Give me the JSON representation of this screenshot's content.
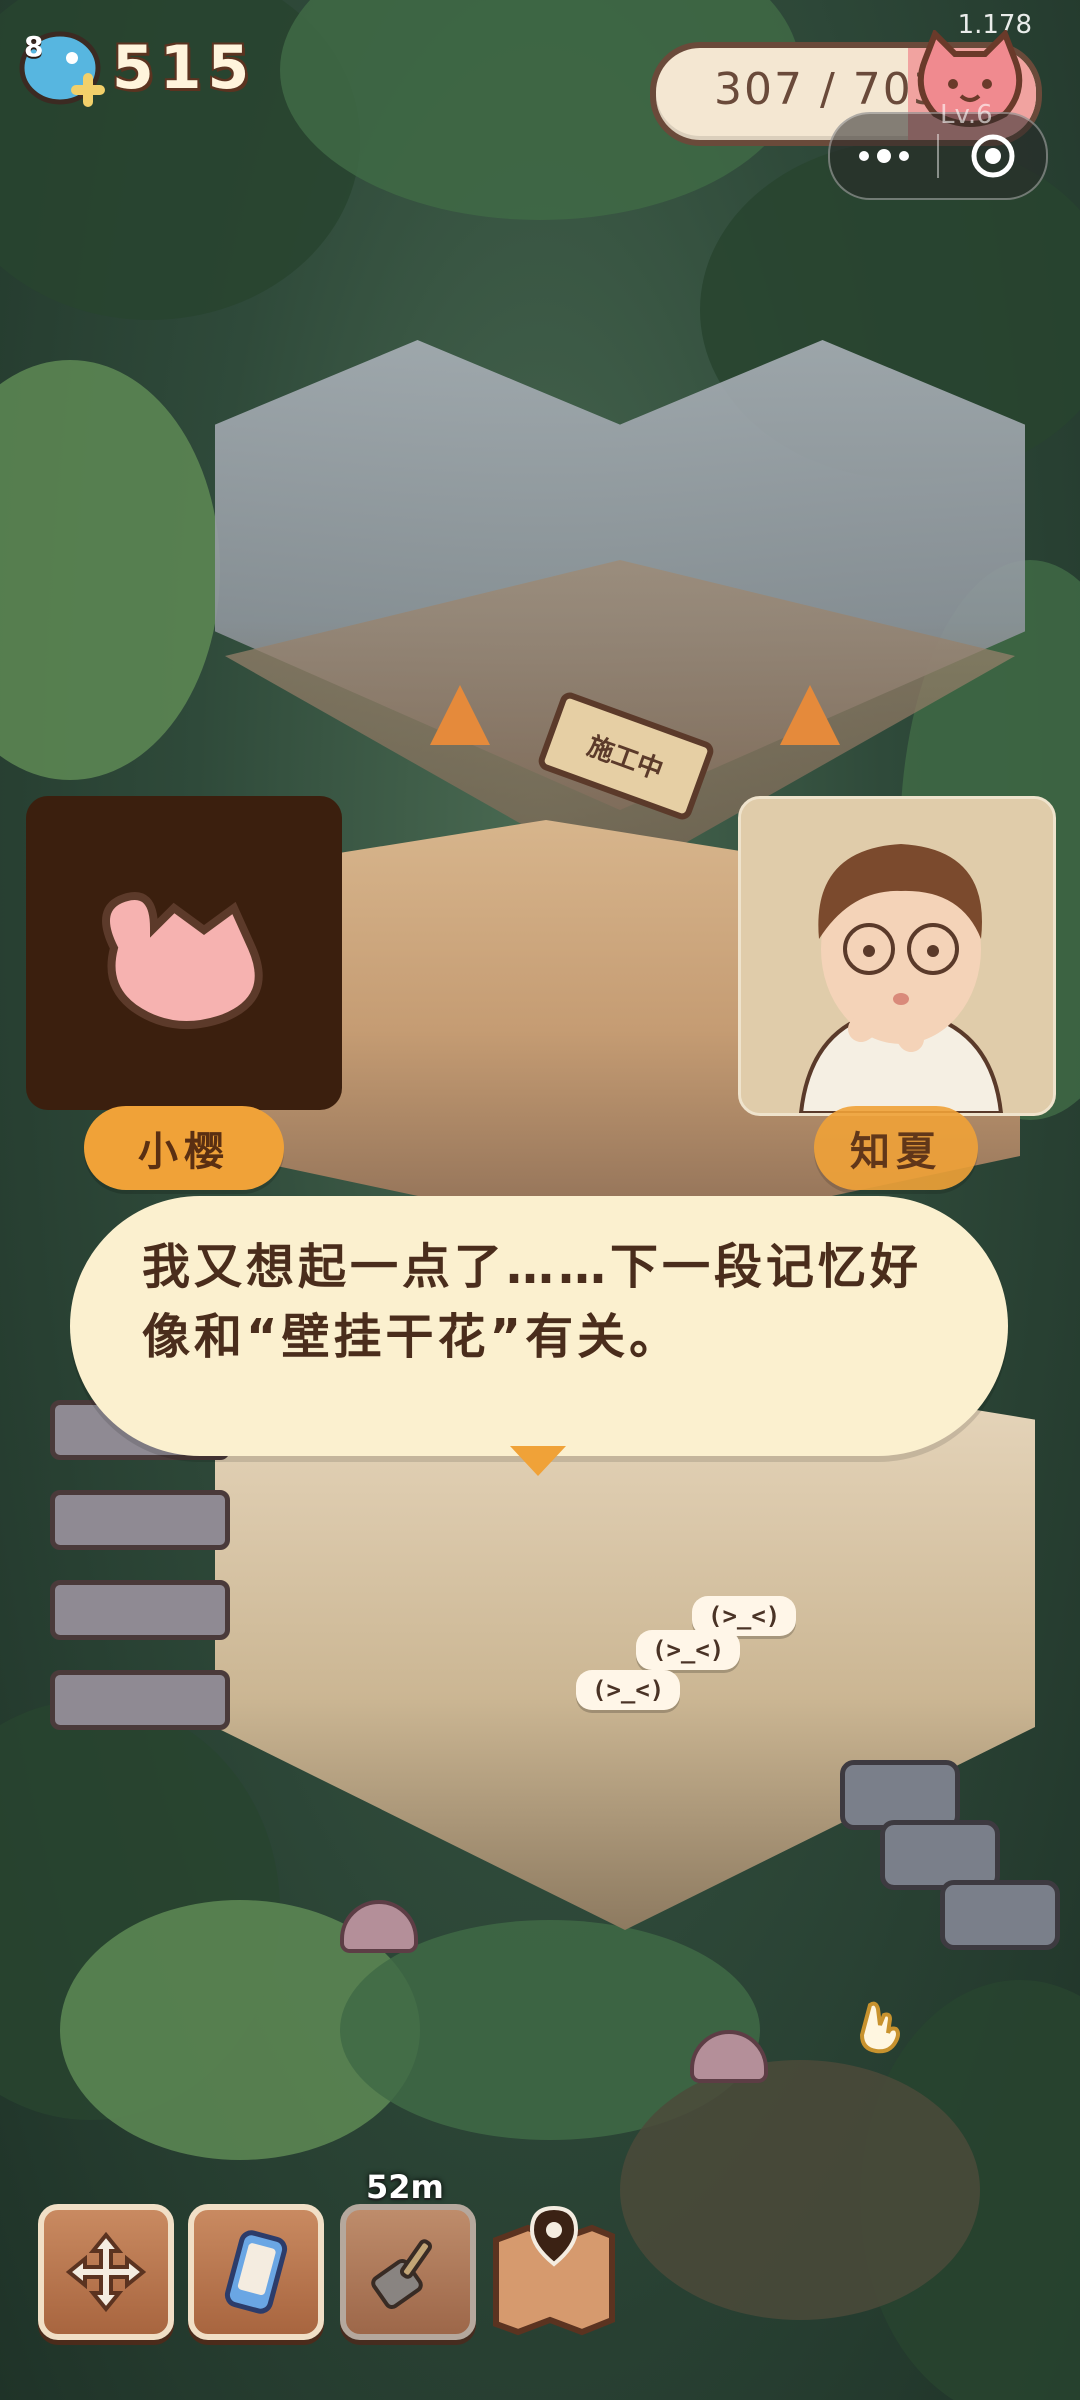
{
  "hud": {
    "level": "8",
    "currency_amount": "515",
    "version": "1.178",
    "progress": {
      "current": 307,
      "max": 703,
      "text": "307 / 703"
    },
    "cat_level": "Lv.6"
  },
  "scene": {
    "sign_text": "施工中",
    "bubbles": [
      "(>_<)",
      "(>_<)",
      "(>_<)"
    ]
  },
  "dialog": {
    "speaker_left": "小樱",
    "speaker_right": "知夏",
    "text": "我又想起一点了……下一段记忆好像和“壁挂干花”有关。"
  },
  "toolbar": {
    "timer": "52m",
    "items": [
      "move-tool",
      "phone-tool",
      "scoop-tool",
      "map-tool"
    ]
  },
  "colors": {
    "accent_orange": "#f0a238",
    "dialog_bg": "#fbf0cf",
    "pink": "#f1a3a0",
    "brown": "#5a2f12"
  }
}
